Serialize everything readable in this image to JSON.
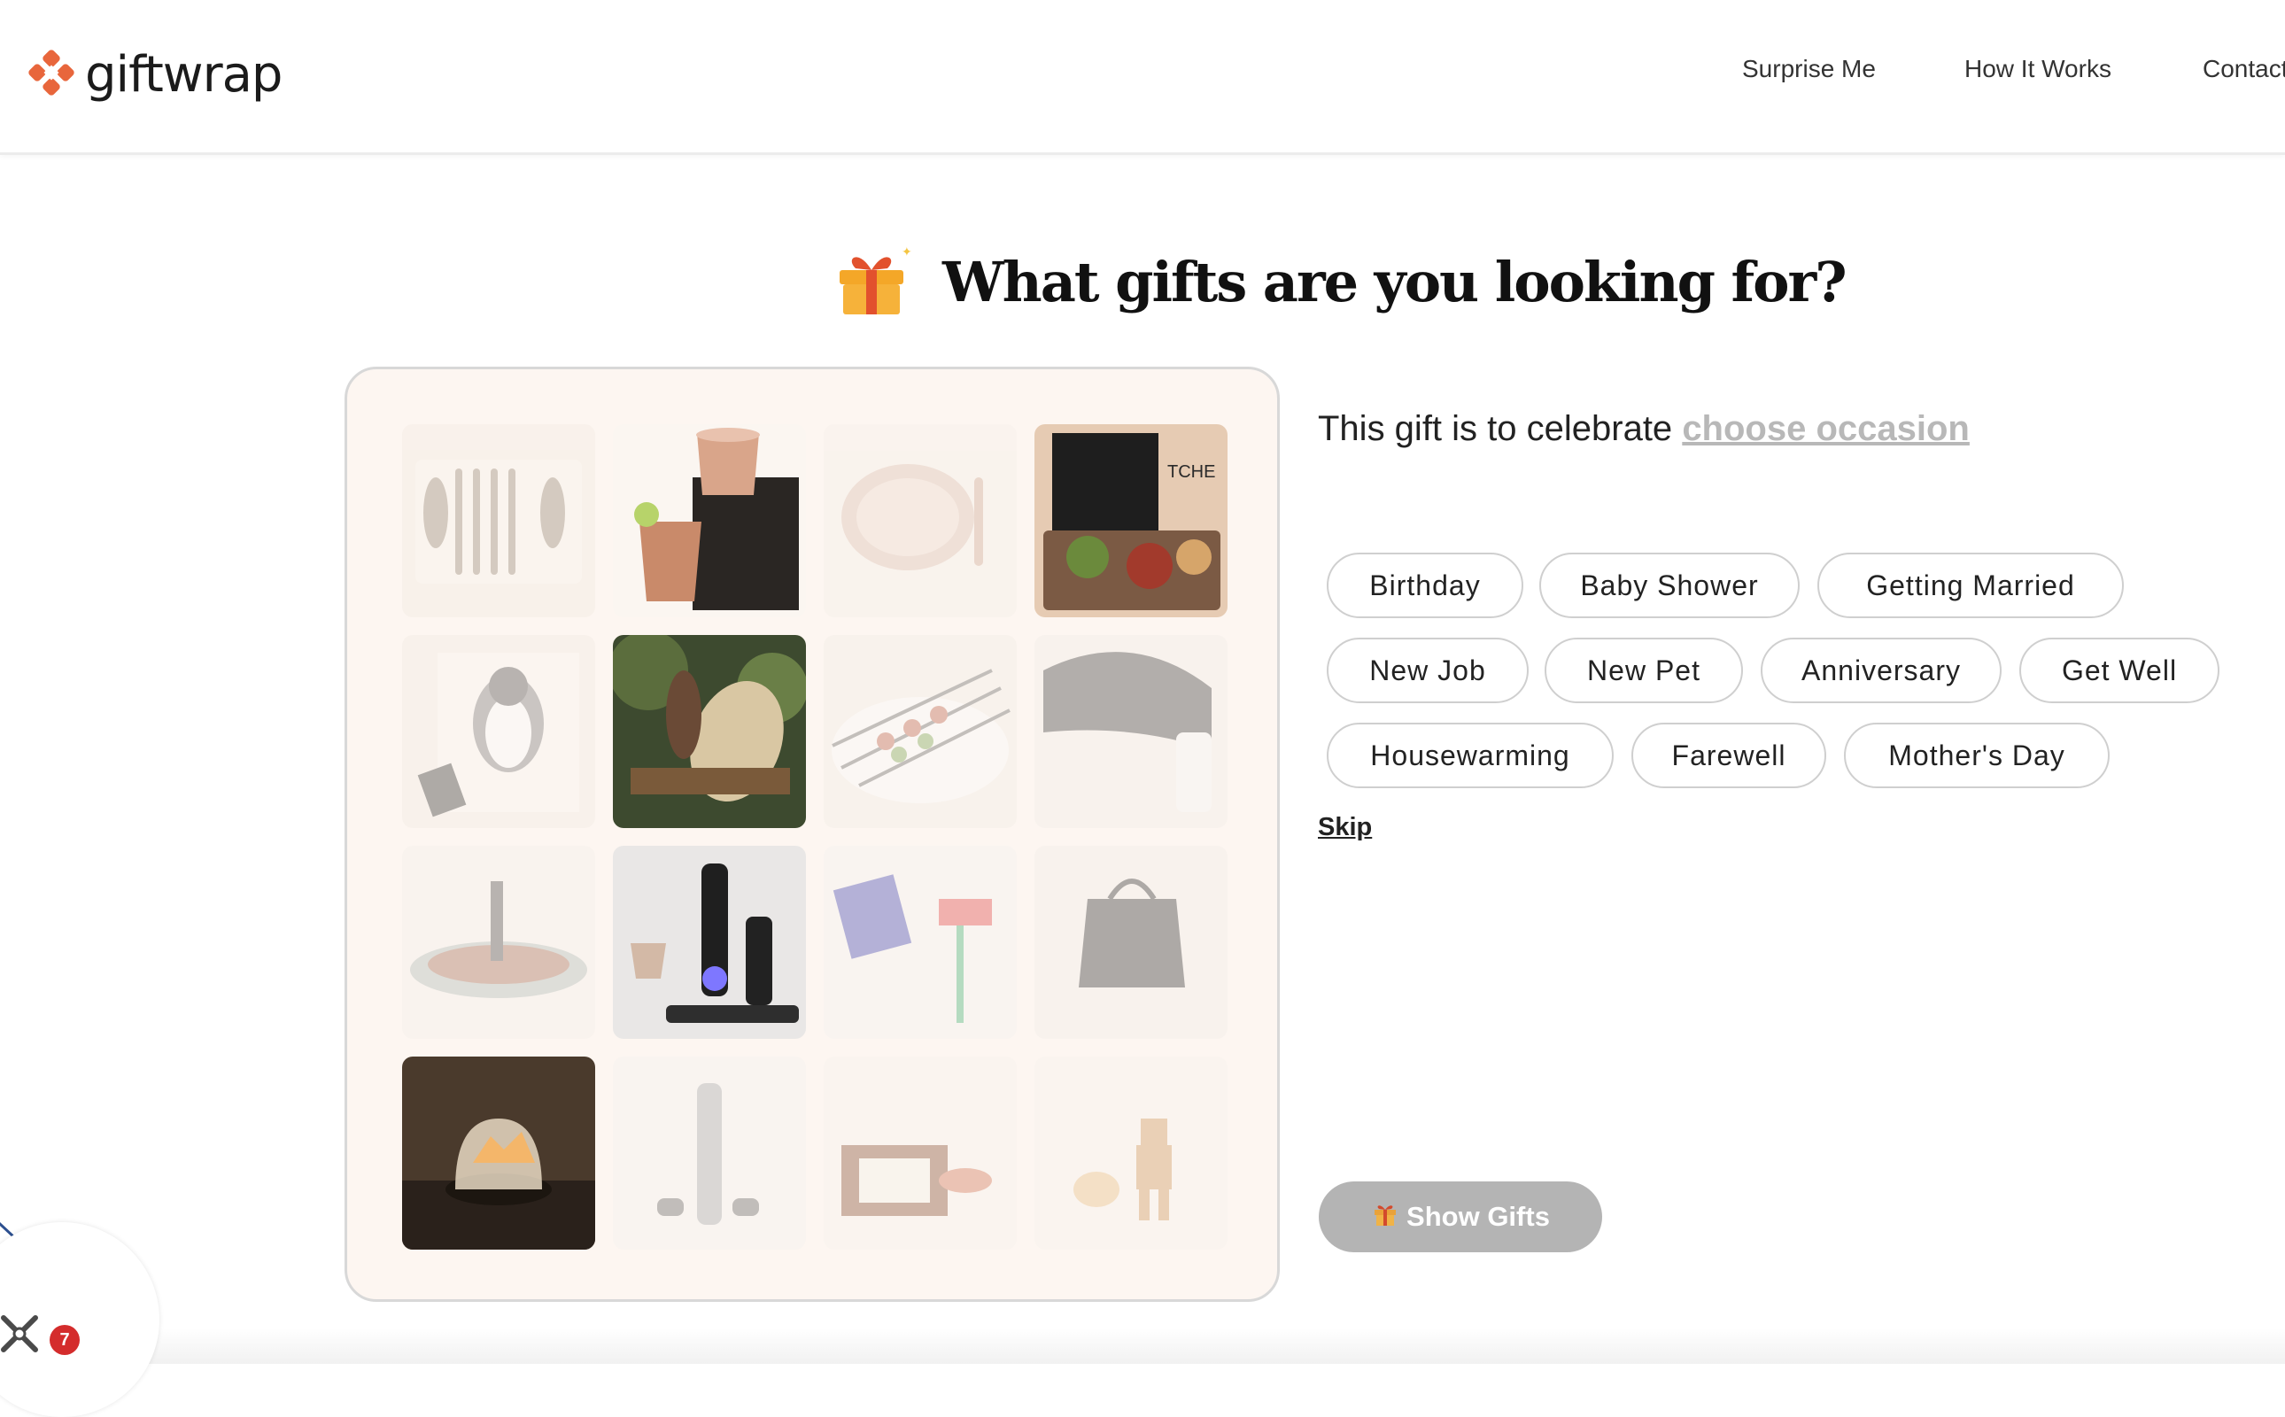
{
  "brand": {
    "name": "giftwrap",
    "accent": "#e8663c"
  },
  "nav": {
    "surprise": "Surprise Me",
    "how": "How It Works",
    "contact": "Contact"
  },
  "page": {
    "title": "What gifts are you looking for?"
  },
  "prompt": {
    "text": "This gift is to celebrate",
    "link": "choose occasion"
  },
  "occasions": [
    "Birthday",
    "Baby Shower",
    "Getting Married",
    "New Job",
    "New Pet",
    "Anniversary",
    "Get Well",
    "Housewarming",
    "Farewell",
    "Mother's Day"
  ],
  "skip_label": "Skip",
  "show_gifts_label": "Show Gifts",
  "widget": {
    "badge": "7"
  },
  "colors": {
    "panel_bg": "#fdf6f1",
    "button_disabled": "#b4b4b4",
    "link_muted": "#b8b8b8"
  }
}
